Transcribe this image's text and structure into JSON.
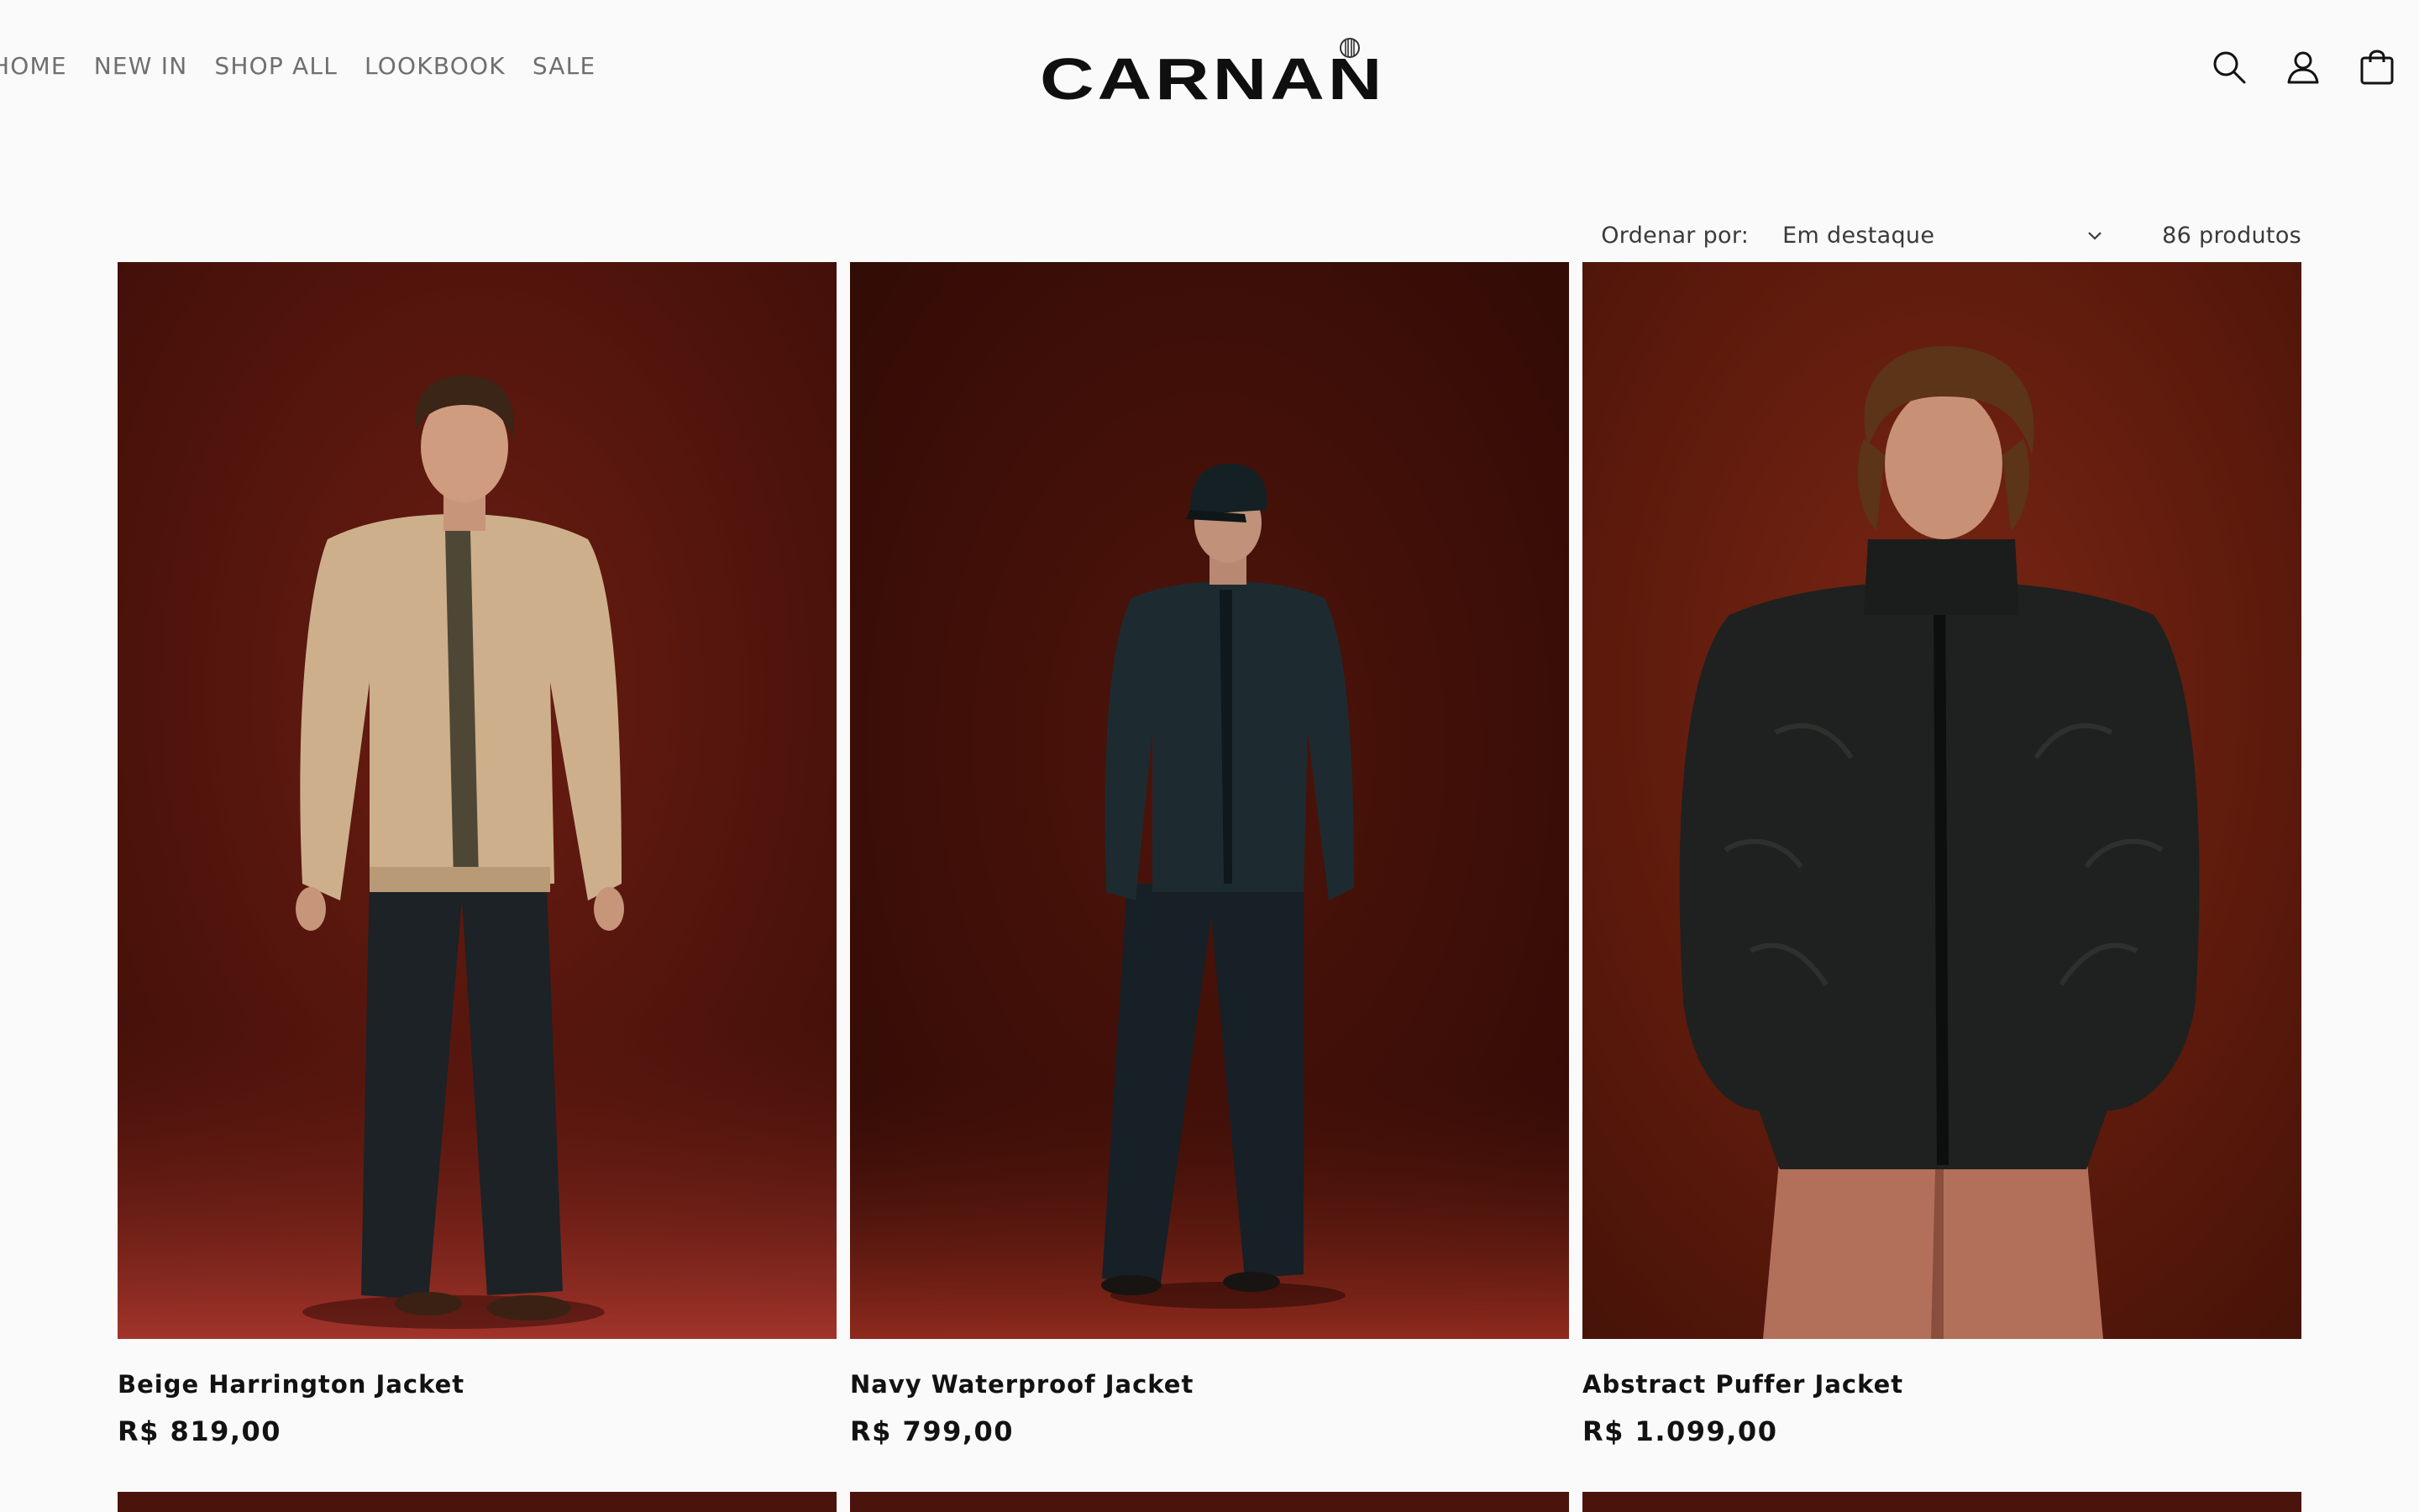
{
  "nav": {
    "links": [
      "HOME",
      "NEW IN",
      "SHOP ALL",
      "LOOKBOOK",
      "SALE"
    ]
  },
  "brand": {
    "name": "CARNAN"
  },
  "header_icons": [
    "search-icon",
    "account-icon",
    "cart-icon"
  ],
  "toolbar": {
    "sort_label": "Ordenar por:",
    "sort_value": "Em destaque",
    "product_count": "86 produtos"
  },
  "products": [
    {
      "title": "Beige Harrington Jacket",
      "price": "R$ 819,00"
    },
    {
      "title": "Navy Waterproof Jacket",
      "price": "R$ 799,00"
    },
    {
      "title": "Abstract Puffer Jacket",
      "price": "R$ 1.099,00"
    }
  ],
  "colors": {
    "background": "#fafafa",
    "photo_backdrop": "#5a1a10",
    "text": "#121212",
    "nav_text": "#6f6f6f"
  }
}
